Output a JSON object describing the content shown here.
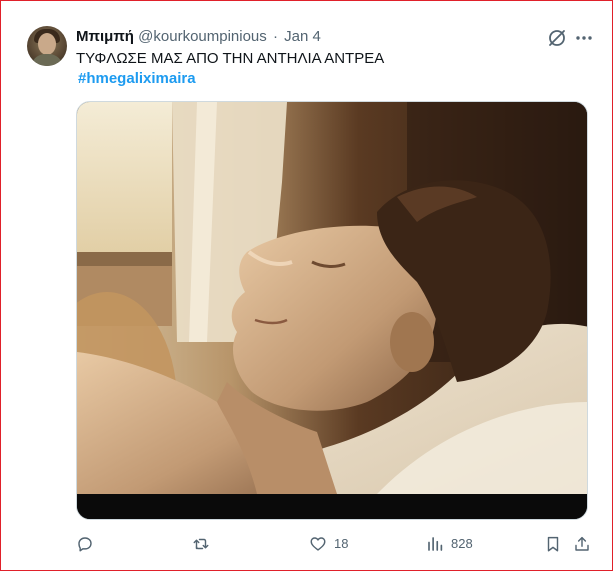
{
  "tweet": {
    "author_name": "Μπιμπή",
    "author_handle": "@kourkoumpinious",
    "separator": "·",
    "date": "Jan 4",
    "text": "ΤΥΦΛΩΣΕ ΜΑΣ ΑΠΟ ΤΗΝ ΑΝΤΗΛΙΑ ΑΝΤΡΕΑ",
    "hashtag": "#hmegaliximaira",
    "media": {
      "kind": "image",
      "description_icon": "photo"
    }
  },
  "actions": {
    "reply": {
      "icon": "reply-icon",
      "count": ""
    },
    "retweet": {
      "icon": "retweet-icon",
      "count": ""
    },
    "like": {
      "icon": "heart-icon",
      "count": "18"
    },
    "views": {
      "icon": "views-icon",
      "count": "828"
    },
    "bookmark": {
      "icon": "bookmark-icon"
    },
    "share": {
      "icon": "share-icon"
    }
  },
  "top_icons": [
    "grok-icon",
    "more-icon"
  ],
  "colors": {
    "frame_border": "#e0202a",
    "text": "#0f1419",
    "secondary": "#536471",
    "link": "#1d9bf0"
  }
}
